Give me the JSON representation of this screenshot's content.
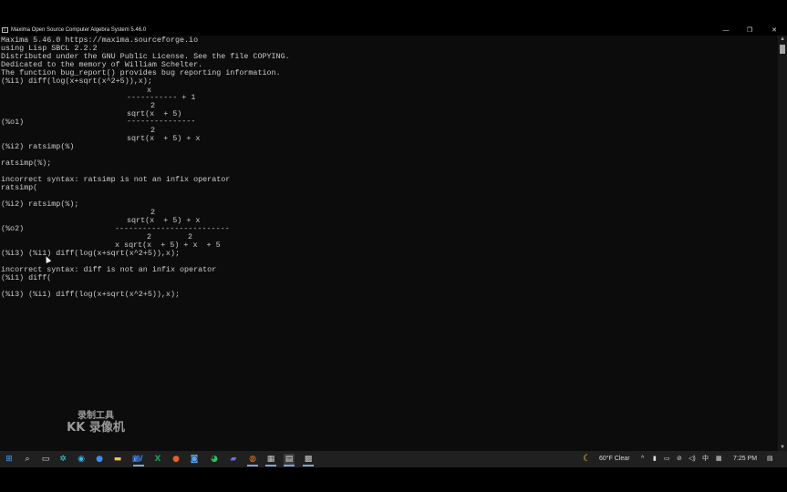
{
  "window": {
    "title": "Maxima Open Source Computer Algebra System 5.46.0",
    "minimize_glyph": "—",
    "maximize_glyph": "❐",
    "close_glyph": "✕"
  },
  "console": {
    "lines": [
      "Maxima 5.46.0 https://maxima.sourceforge.io",
      "using Lisp SBCL 2.2.2",
      "Distributed under the GNU Public License. See the file COPYING.",
      "Dedicated to the memory of William Schelter.",
      "The function bug_report() provides bug reporting information.",
      "(%i1) diff(log(x+sqrt(x^2+5)),x);",
      "(%o1)",
      "(%i2) ratsimp(%)",
      "ratsimp(%);",
      "incorrect syntax: ratsimp is not an infix operator",
      "ratsimp(",
      "(%i2) ratsimp(%);",
      "(%o2)",
      "(%i3) (%i1) diff(log(x+sqrt(x^2+5)),x);",
      "incorrect syntax: diff is not an infix operator",
      "(%i1) diff(",
      "(%i3) (%i1) diff(log(x+sqrt(x^2+5)),x);"
    ],
    "o1_parts": {
      "num_x": "x",
      "inner_bar": "----------- + 1",
      "exp1": "2",
      "inner_den": "sqrt(x  + 5)",
      "main_bar": "---------------",
      "exp2": "2",
      "den": "sqrt(x  + 5) + x"
    },
    "o2_parts": {
      "exp_num": "2",
      "num": "sqrt(x  + 5) + x",
      "bar": "-------------------------",
      "exp_a": "2",
      "exp_b": "2",
      "den": "x sqrt(x  + 5) + x  + 5"
    }
  },
  "watermark": {
    "line1": "录制工具",
    "line2": "KK 录像机"
  },
  "taskbar": {
    "icons": [
      "windows-start-icon",
      "search-icon",
      "task-view-icon",
      "settings-icon",
      "edge-icon",
      "browser-icon",
      "file-explorer-icon",
      "store-icon",
      "word-icon",
      "excel-icon",
      "office-icon",
      "app-icon",
      "wechat-icon",
      "teams-icon",
      "browser2-icon",
      "app2-icon",
      "terminal-icon",
      "app3-icon"
    ],
    "weather": "60°F  Clear",
    "weather_icon": "moon-icon",
    "ime": "中",
    "time": "7:25 PM"
  },
  "colors": {
    "console_bg": "#0c0c0c",
    "console_text": "#cccccc",
    "taskbar_bg": "#202020"
  }
}
